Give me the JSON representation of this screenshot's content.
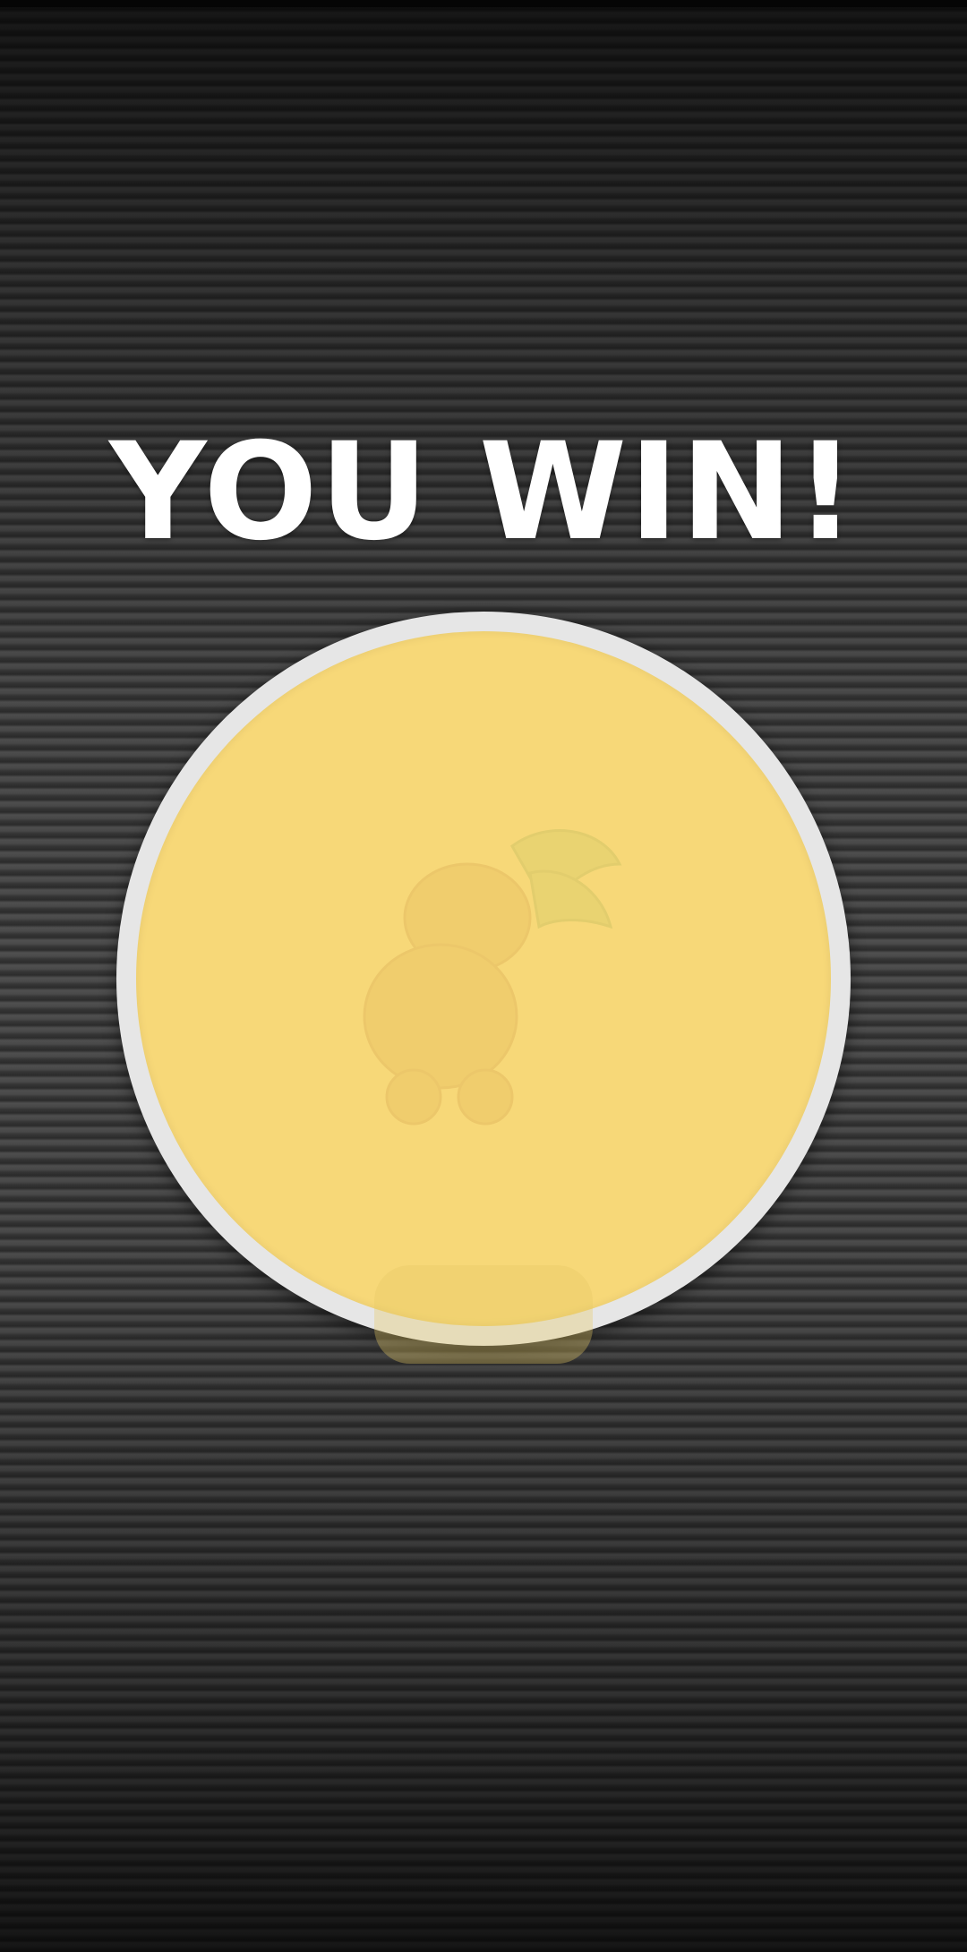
{
  "screen": {
    "title": "YOU WIN!"
  },
  "colors": {
    "coin_fill": "#f7d878",
    "coin_rim": "#e6e6e6",
    "title_text": "#ffffff",
    "background": "#3a3a3a"
  },
  "icons": {
    "coin_art": "faded-character-illustration-icon"
  }
}
